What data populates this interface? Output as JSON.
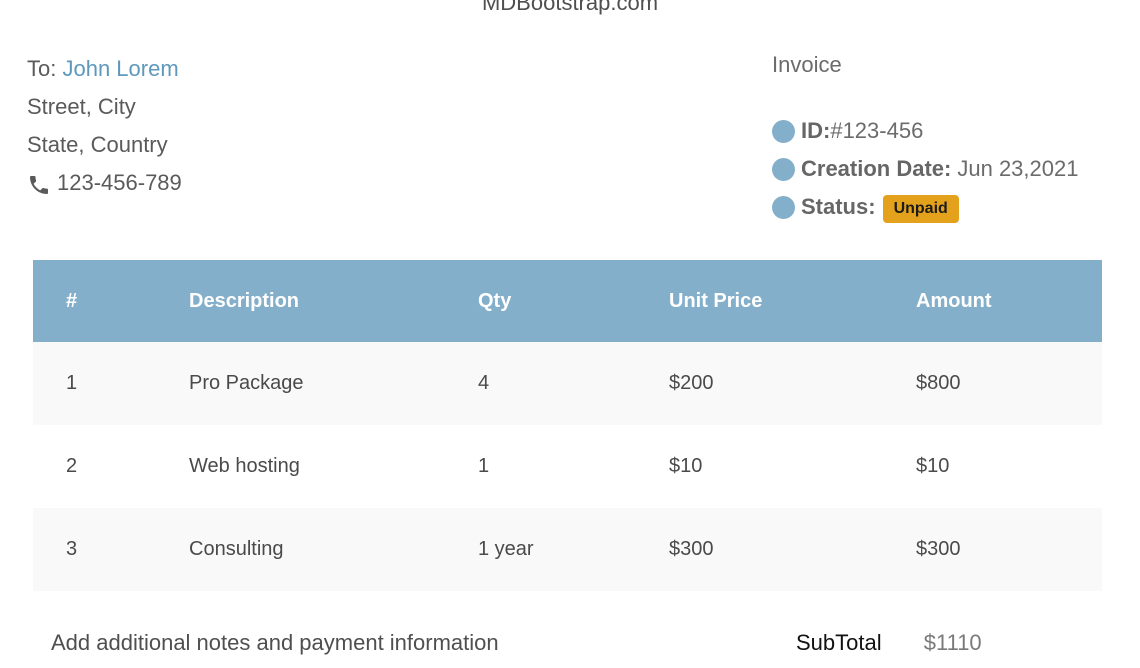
{
  "site": {
    "title": "MDBootstrap.com"
  },
  "bill_to": {
    "prefix": "To:",
    "name": "John Lorem",
    "street": "Street, City",
    "region": "State, Country",
    "phone": "123-456-789",
    "phone_icon": "phone-icon"
  },
  "invoice": {
    "heading": "Invoice",
    "id_label": "ID:",
    "id_value": "#123-456",
    "date_label": "Creation Date:",
    "date_value": "Jun 23,2021",
    "status_label": "Status:",
    "status_value": "Unpaid",
    "status_color": "#e4a11b",
    "bullet_color": "#84afca"
  },
  "table": {
    "headers": [
      "#",
      "Description",
      "Qty",
      "Unit Price",
      "Amount"
    ],
    "header_color": "#84afca",
    "rows": [
      [
        "1",
        "Pro Package",
        "4",
        "$200",
        "$800"
      ],
      [
        "2",
        "Web hosting",
        "1",
        "$10",
        "$10"
      ],
      [
        "3",
        "Consulting",
        "1 year",
        "$300",
        "$300"
      ]
    ]
  },
  "footer": {
    "notes": "Add additional notes and payment information",
    "subtotal_label": "SubTotal",
    "subtotal_value": "$1110"
  }
}
